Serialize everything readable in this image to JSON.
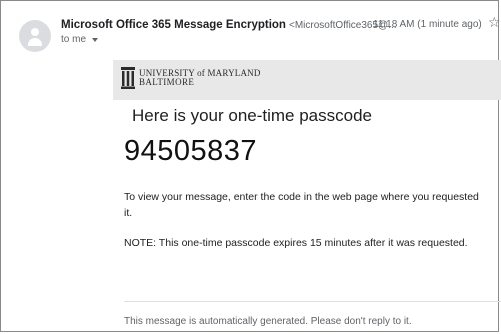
{
  "header": {
    "sender_name": "Microsoft Office 365 Message Encryption",
    "sender_email": "<MicrosoftOffice365@...",
    "timestamp": "11:18 AM (1 minute ago)",
    "recipient": "to me"
  },
  "brand": {
    "line1": "UNIVERSITY of MARYLAND",
    "line2": "BALTIMORE"
  },
  "message": {
    "heading": "Here is your one-time passcode",
    "code": "94505837",
    "instructions": "To view your message, enter the code in the web page where you requested it.",
    "note": "NOTE: This one-time passcode expires 15 minutes after it was requested.",
    "footer": "This message is automatically generated. Please don't reply to it."
  },
  "icons": {
    "avatar": "person-avatar-icon",
    "star": "star-outline-icon",
    "caret": "caret-down-icon",
    "logo": "university-columns-logo"
  },
  "colors": {
    "brand_bar": "#e8e8e8",
    "secondary_text": "#5f6368",
    "primary_text": "#202124"
  }
}
